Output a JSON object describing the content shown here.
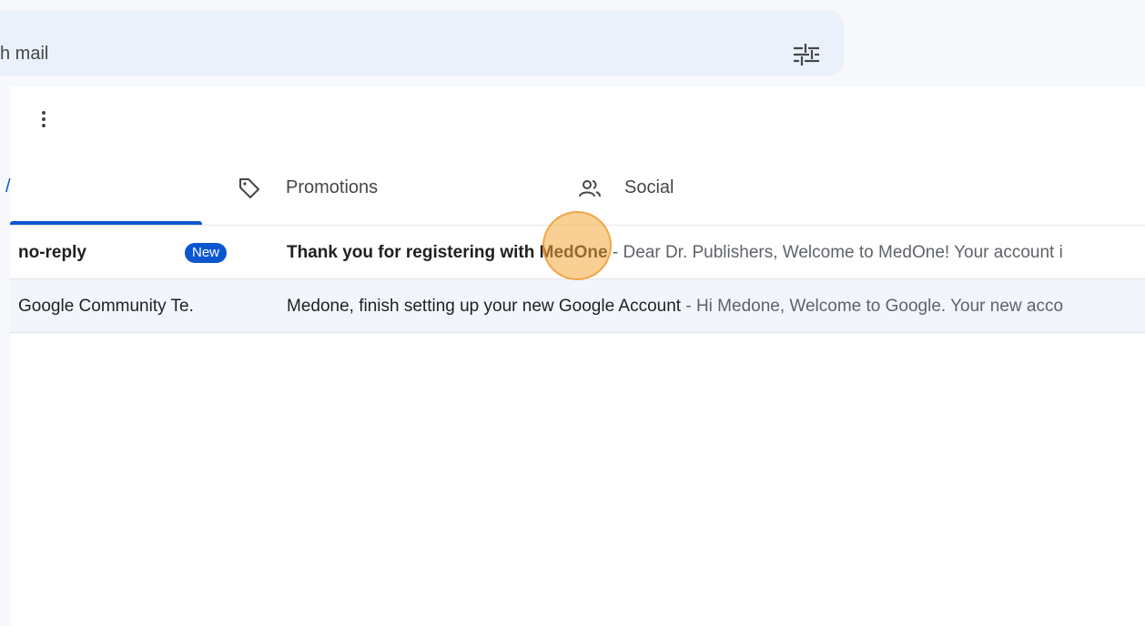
{
  "search": {
    "partial_text": "h mail"
  },
  "toolbar": {
    "more_icon": "more-vert-icon",
    "filter_icon": "tune-icon"
  },
  "tabs": {
    "primary_fragment": "/",
    "promotions": {
      "label": "Promotions",
      "icon": "tag-icon"
    },
    "social": {
      "label": "Social",
      "icon": "people-icon"
    }
  },
  "emails": [
    {
      "sender": "no-reply",
      "badge": "New",
      "subject": "Thank you for registering with MedOne",
      "separator": " - ",
      "snippet": "Dear Dr. Publishers, Welcome to MedOne! Your account i",
      "unread": true
    },
    {
      "sender": "Google Community Te.",
      "subject": "Medone, finish setting up your new Google Account",
      "separator": " - ",
      "snippet": "Hi Medone, Welcome to Google. Your new acco",
      "unread": false
    }
  ],
  "colors": {
    "accent": "#0b57d0",
    "search_bg": "#eaf1fb",
    "app_bg": "#f6f8fc",
    "highlight": "#f4a83c"
  }
}
